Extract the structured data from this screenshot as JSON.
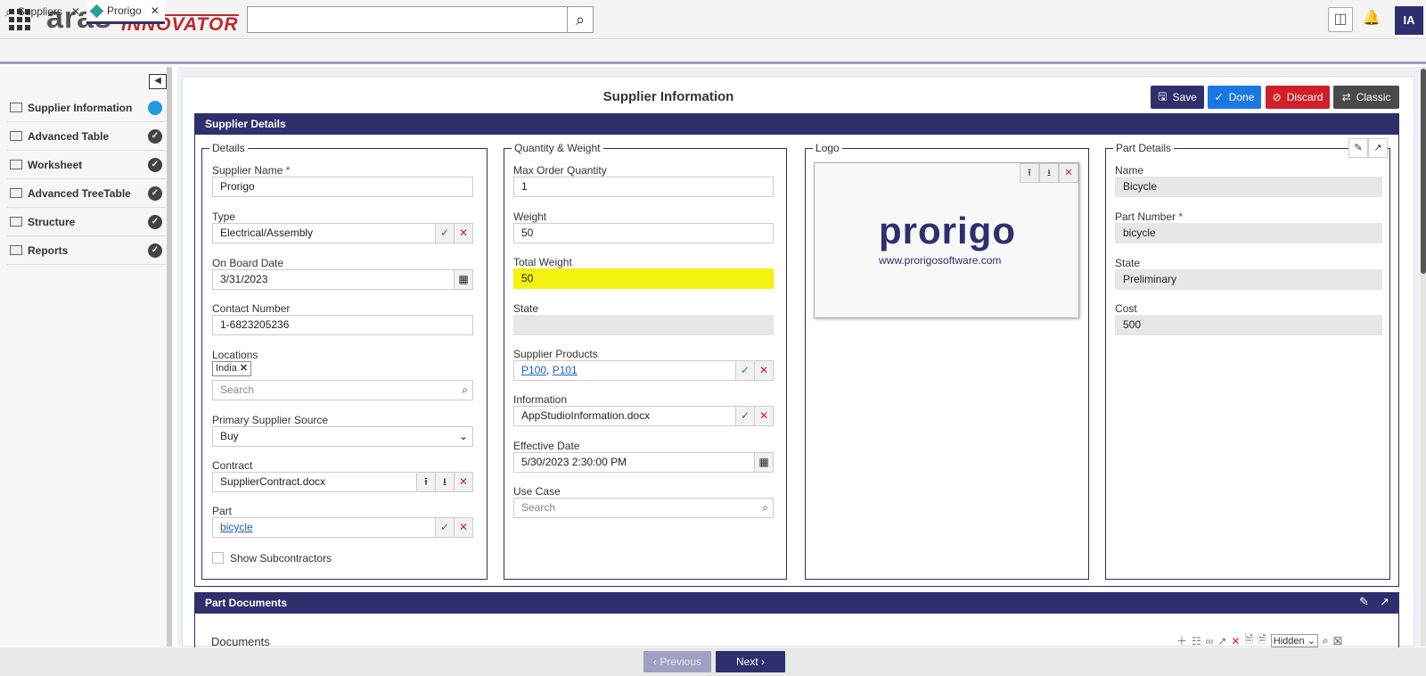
{
  "app": {
    "logo_main": "aras",
    "logo_sub": "INNOVATOR",
    "user_initials": "IA"
  },
  "tabs": [
    {
      "label": "Suppliers"
    },
    {
      "label": "Prorigo"
    }
  ],
  "sidebar": {
    "items": [
      {
        "label": "Supplier Information",
        "status": "current"
      },
      {
        "label": "Advanced Table",
        "status": "done"
      },
      {
        "label": "Worksheet",
        "status": "done"
      },
      {
        "label": "Advanced TreeTable",
        "status": "done"
      },
      {
        "label": "Structure",
        "status": "done"
      },
      {
        "label": "Reports",
        "status": "done"
      }
    ]
  },
  "page": {
    "title": "Supplier Information"
  },
  "actions": {
    "save": "Save",
    "done": "Done",
    "discard": "Discard",
    "classic": "Classic"
  },
  "section1": {
    "title": "Supplier Details"
  },
  "details": {
    "legend": "Details",
    "supplier_name_label": "Supplier Name",
    "supplier_name": "Prorigo",
    "type_label": "Type",
    "type": "Electrical/Assembly",
    "onboard_label": "On Board Date",
    "onboard": "3/31/2023",
    "contact_label": "Contact Number",
    "contact": "1-6823205236",
    "locations_label": "Locations",
    "location_tag": "India",
    "locations_placeholder": "Search",
    "source_label": "Primary Supplier Source",
    "source": "Buy",
    "contract_label": "Contract",
    "contract": "SupplierContract.docx",
    "part_label": "Part",
    "part": "bicycle",
    "subcontractors_label": "Show Subcontractors"
  },
  "quantity": {
    "legend": "Quantity & Weight",
    "max_order_label": "Max Order Quantity",
    "max_order": "1",
    "weight_label": "Weight",
    "weight": "50",
    "total_weight_label": "Total Weight",
    "total_weight": "50",
    "state_label": "State",
    "state": "",
    "products_label": "Supplier Products",
    "product1": "P100",
    "product2": "P101",
    "information_label": "Information",
    "information": "AppStudioInformation.docx",
    "effective_label": "Effective Date",
    "effective": "5/30/2023 2:30:00 PM",
    "usecase_label": "Use Case",
    "usecase_placeholder": "Search"
  },
  "logo": {
    "legend": "Logo",
    "brand": "prorigo",
    "url": "www.prorigosoftware.com"
  },
  "part_details": {
    "legend": "Part Details",
    "name_label": "Name",
    "name": "Bicycle",
    "number_label": "Part Number",
    "number": "bicycle",
    "state_label": "State",
    "state": "Preliminary",
    "cost_label": "Cost",
    "cost": "500"
  },
  "section2": {
    "title": "Part Documents",
    "subtitle": "Documents",
    "view_select": "Hidden"
  },
  "pager": {
    "previous": "Previous",
    "next": "Next"
  },
  "colors": {
    "navy": "#2f2f6e",
    "done_blue": "#1a78e5",
    "discard_red": "#d11f2a",
    "highlight": "#f4f20f",
    "accent_teal": "#2aa198"
  }
}
